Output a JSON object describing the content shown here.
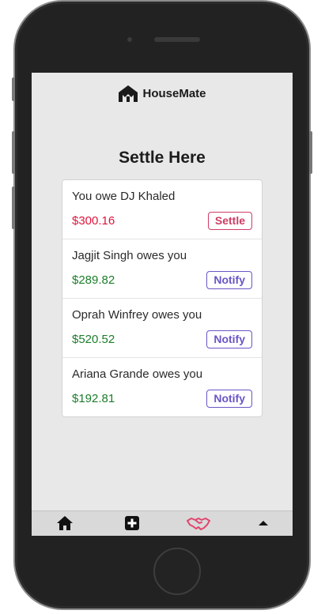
{
  "app": {
    "brand_name": "HouseMate",
    "brand_logo_icon": "housemate-logo-icon"
  },
  "page": {
    "title": "Settle Here"
  },
  "balances": [
    {
      "text": "You owe DJ Khaled",
      "amount": "$300.16",
      "direction": "owe",
      "action": "Settle"
    },
    {
      "text": "Jagjit Singh owes you",
      "amount": "$289.82",
      "direction": "owed",
      "action": "Notify"
    },
    {
      "text": "Oprah Winfrey owes you",
      "amount": "$520.52",
      "direction": "owed",
      "action": "Notify"
    },
    {
      "text": "Ariana Grande owes you",
      "amount": "$192.81",
      "direction": "owed",
      "action": "Notify"
    }
  ],
  "tabbar": {
    "items": [
      {
        "icon": "home-icon",
        "active": false
      },
      {
        "icon": "plus-square-icon",
        "active": false
      },
      {
        "icon": "handshake-icon",
        "active": true
      },
      {
        "icon": "caret-up-icon",
        "active": false
      }
    ]
  },
  "colors": {
    "owe": "#e0143c",
    "owed": "#1c7d2a",
    "settle_accent": "#cf3c63",
    "notify_accent": "#6a55c6",
    "active_tab": "#e0466e"
  }
}
